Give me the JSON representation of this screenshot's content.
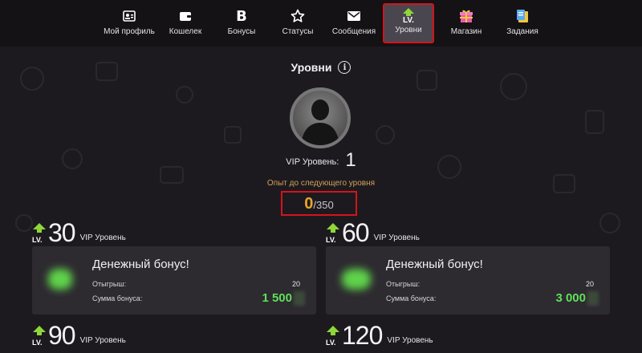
{
  "nav": {
    "items": [
      {
        "label": "Мой профиль",
        "icon": "profile-card-icon"
      },
      {
        "label": "Кошелек",
        "icon": "wallet-icon"
      },
      {
        "label": "Бонусы",
        "icon": "bonus-b-icon"
      },
      {
        "label": "Статусы",
        "icon": "star-icon"
      },
      {
        "label": "Сообщения",
        "icon": "envelope-icon"
      },
      {
        "label": "Уровни",
        "icon": "level-up-icon",
        "badge": "LV.",
        "active": true
      },
      {
        "label": "Магазин",
        "icon": "gift-icon"
      },
      {
        "label": "Задания",
        "icon": "clipboard-icon"
      }
    ]
  },
  "page": {
    "title": "Уровни",
    "info_icon": "i"
  },
  "vip": {
    "label": "VIP Уровень:",
    "value": "1",
    "exp_caption": "Опыт до следующего уровня",
    "exp_current": "0",
    "exp_separator": "/",
    "exp_total": "350"
  },
  "levels": [
    {
      "badge": "LV.",
      "number": "30",
      "caption": "VIP Уровень",
      "card": {
        "title": "Денежный бонус!",
        "wager_label": "Отыгрыш:",
        "wager_value": "20",
        "sum_label": "Сумма бонуса:",
        "sum_value": "1 500"
      }
    },
    {
      "badge": "LV.",
      "number": "60",
      "caption": "VIP Уровень",
      "card": {
        "title": "Денежный бонус!",
        "wager_label": "Отыгрыш:",
        "wager_value": "20",
        "sum_label": "Сумма бонуса:",
        "sum_value": "3 000"
      }
    },
    {
      "badge": "LV.",
      "number": "90",
      "caption": "VIP Уровень"
    },
    {
      "badge": "LV.",
      "number": "120",
      "caption": "VIP Уровень"
    }
  ],
  "colors": {
    "background": "#1d1a1f",
    "topbar": "#141215",
    "highlight": "#d4141b",
    "accent_green": "#5fe05a",
    "exp_orange": "#e8a62d",
    "card": "#2d2a30"
  }
}
